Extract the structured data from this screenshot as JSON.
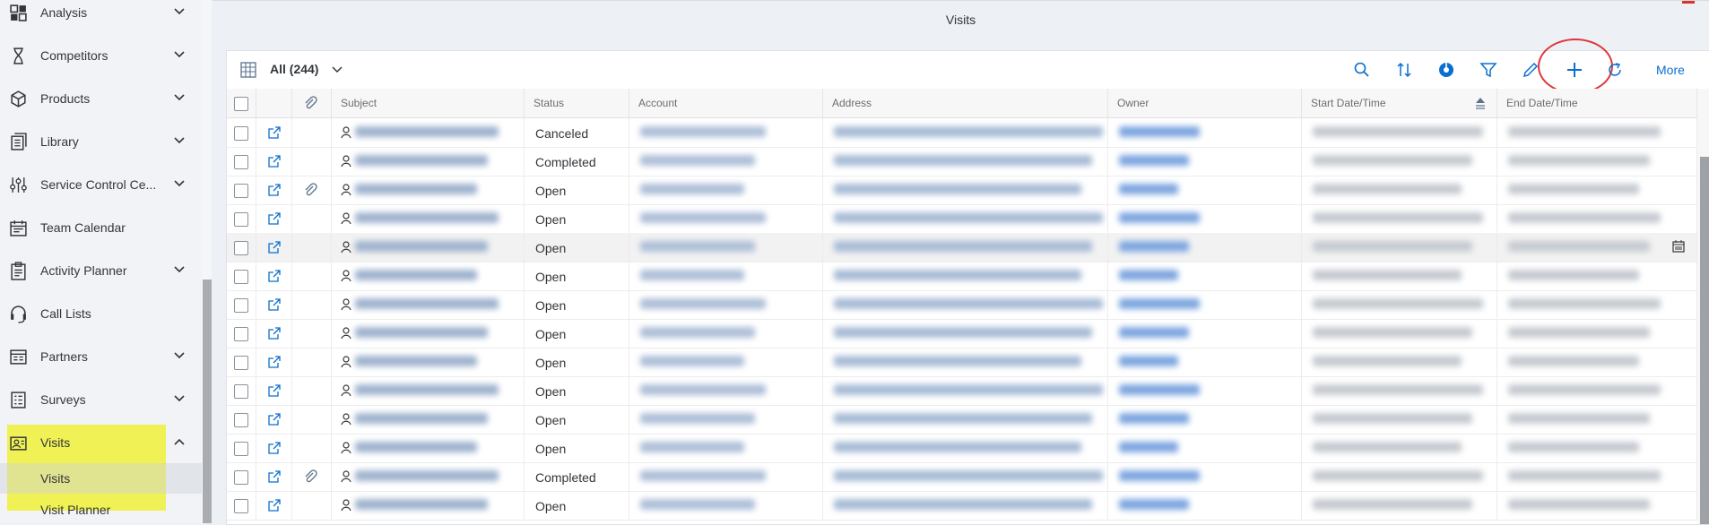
{
  "sidebar": {
    "items": [
      {
        "label": "Analysis",
        "icon": "analysis-icon",
        "expandable": true
      },
      {
        "label": "Competitors",
        "icon": "hourglass-icon",
        "expandable": true
      },
      {
        "label": "Products",
        "icon": "product-box-icon",
        "expandable": true
      },
      {
        "label": "Library",
        "icon": "library-icon",
        "expandable": true
      },
      {
        "label": "Service Control Ce...",
        "icon": "controls-sliders-icon",
        "expandable": true
      },
      {
        "label": "Team Calendar",
        "icon": "calendar-icon",
        "expandable": false
      },
      {
        "label": "Activity Planner",
        "icon": "activity-planner-icon",
        "expandable": true
      },
      {
        "label": "Call Lists",
        "icon": "headset-icon",
        "expandable": false
      },
      {
        "label": "Partners",
        "icon": "partners-icon",
        "expandable": true
      },
      {
        "label": "Surveys",
        "icon": "survey-icon",
        "expandable": true
      },
      {
        "label": "Visits",
        "icon": "visits-icon",
        "expandable": true,
        "expanded": true
      }
    ],
    "sub_items": [
      {
        "label": "Visits",
        "selected": true
      },
      {
        "label": "Visit Planner"
      }
    ]
  },
  "page": {
    "title": "Visits"
  },
  "toolbar": {
    "view_label": "All  (244)",
    "more_label": "More",
    "icons": [
      "search-icon",
      "sort-icon",
      "group-icon",
      "filter-icon",
      "edit-icon",
      "add-icon",
      "refresh-icon"
    ]
  },
  "table": {
    "columns": [
      "Subject",
      "Status",
      "Account",
      "Address",
      "Owner",
      "Start Date/Time",
      "End Date/Time"
    ],
    "rows": [
      {
        "status": "Canceled",
        "attachment": false
      },
      {
        "status": "Completed",
        "attachment": false
      },
      {
        "status": "Open",
        "attachment": true
      },
      {
        "status": "Open",
        "attachment": false
      },
      {
        "status": "Open",
        "attachment": false,
        "selected": true
      },
      {
        "status": "Open",
        "attachment": false
      },
      {
        "status": "Open",
        "attachment": false
      },
      {
        "status": "Open",
        "attachment": false
      },
      {
        "status": "Open",
        "attachment": false
      },
      {
        "status": "Open",
        "attachment": false
      },
      {
        "status": "Open",
        "attachment": false
      },
      {
        "status": "Open",
        "attachment": false
      },
      {
        "status": "Completed",
        "attachment": true
      },
      {
        "status": "Open",
        "attachment": false
      }
    ]
  },
  "colors": {
    "accent": "#0a6ed1",
    "highlight": "#f0f028",
    "callout": "#e0353b"
  }
}
